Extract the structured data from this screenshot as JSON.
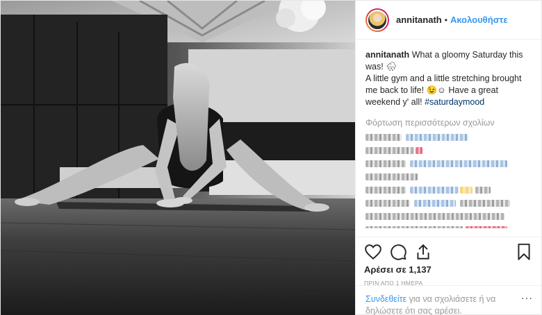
{
  "post": {
    "username": "annitanath",
    "separator": "•",
    "follow_label": "Ακολουθήστε",
    "caption": {
      "username": "annitanath",
      "text_line1": "What a gloomy Saturday this was! ",
      "emoji1": "🌧",
      "text_line2": "A little gym and a little stretching brought me back to life! ",
      "emoji2": "😉☺",
      "text_line3": " Have a great weekend y' all! ",
      "hashtag": "#saturdaymood"
    },
    "load_more_label": "Φόρτωση περισσότερων σχολίων",
    "likes_label": "Αρέσει σε 1,137",
    "timestamp": "ΠΡΙΝ ΑΠΟ 1 ΗΜΕΡΑ",
    "login_link": "Συνδεθείτε",
    "login_text": " για να σχολιάσετε ή να δηλώσετε ότι σας αρέσει.",
    "more_options": "···"
  },
  "icons": {
    "like": "heart-icon",
    "comment": "comment-icon",
    "share": "share-icon",
    "save": "bookmark-icon"
  },
  "colors": {
    "link_blue": "#3897f0",
    "hashtag": "#003569",
    "muted": "#999999",
    "text": "#262626",
    "border": "#efefef"
  }
}
